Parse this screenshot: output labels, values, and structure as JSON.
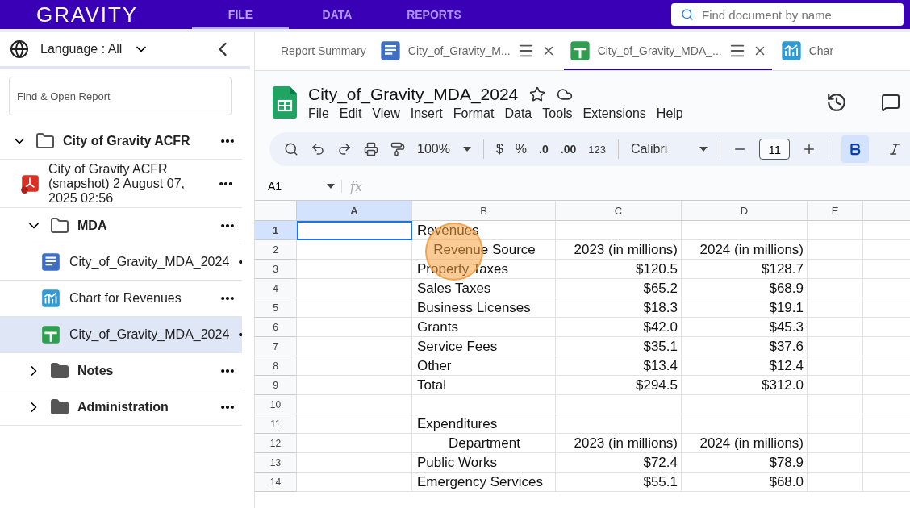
{
  "header": {
    "logo": "GRAVITY",
    "nav": [
      {
        "label": "FILE",
        "selected": true
      },
      {
        "label": "DATA",
        "selected": false
      },
      {
        "label": "REPORTS",
        "selected": false
      }
    ],
    "search": {
      "placeholder": "Find document by name"
    }
  },
  "sidebar": {
    "language": "Language : All",
    "search": {
      "placeholder": "Find & Open Report"
    },
    "tree": [
      {
        "label": "City of Gravity ACFR",
        "kind": "folder",
        "expanded": true,
        "children": [
          {
            "label": "City of Gravity ACFR (snapshot) 2 August 07, 2025 02:56",
            "kind": "pdf",
            "selected": false
          },
          {
            "label": "MDA",
            "kind": "folder",
            "expanded": true,
            "children": [
              {
                "label": "City_of_Gravity_MDA_2024",
                "kind": "doc",
                "selected": false
              },
              {
                "label": "Chart for Revenues",
                "kind": "chart",
                "selected": false
              },
              {
                "label": "City_of_Gravity_MDA_2024",
                "kind": "sheet",
                "selected": true
              }
            ]
          },
          {
            "label": "Notes",
            "kind": "folder",
            "expanded": false
          },
          {
            "label": "Administration",
            "kind": "folder",
            "expanded": false
          }
        ]
      }
    ]
  },
  "tabs": [
    {
      "label": "Report Summary",
      "kind": "text",
      "selected": false,
      "closable": false
    },
    {
      "label": "City_of_Gravity_M...",
      "kind": "doc",
      "selected": false,
      "closable": true
    },
    {
      "label": "City_of_Gravity_MDA_...",
      "kind": "sheet",
      "selected": true,
      "closable": true
    },
    {
      "label": "Char",
      "kind": "chart",
      "selected": false,
      "closable": false
    }
  ],
  "document": {
    "title": "City_of_Gravity_MDA_2024",
    "menu": [
      "File",
      "Edit",
      "View",
      "Insert",
      "Format",
      "Data",
      "Tools",
      "Extensions",
      "Help"
    ],
    "toolbar": [
      {
        "kind": "search"
      },
      {
        "kind": "undo"
      },
      {
        "kind": "redo"
      },
      {
        "kind": "print"
      },
      {
        "kind": "paint"
      },
      {
        "kind": "dropdown",
        "label": "100%"
      },
      {
        "kind": "divider"
      },
      {
        "kind": "text",
        "label": "$"
      },
      {
        "kind": "text",
        "label": "%"
      },
      {
        "kind": "decrease",
        "label": ".0"
      },
      {
        "kind": "increase",
        "label": ".00"
      },
      {
        "kind": "text",
        "label": "123"
      },
      {
        "kind": "divider"
      },
      {
        "kind": "font",
        "label": "Calibri"
      },
      {
        "kind": "divider"
      },
      {
        "kind": "minus"
      },
      {
        "kind": "size",
        "label": "11"
      },
      {
        "kind": "plus"
      },
      {
        "kind": "divider"
      },
      {
        "kind": "bold",
        "selected": true
      },
      {
        "kind": "italic",
        "selected": false
      }
    ],
    "name_box": "A1",
    "formula_label": "fx",
    "columns": [
      {
        "label": "A",
        "selected": true
      },
      {
        "label": "B",
        "selected": false
      },
      {
        "label": "C",
        "selected": false
      },
      {
        "label": "D",
        "selected": false
      },
      {
        "label": "E",
        "selected": false
      }
    ],
    "rows": [
      {
        "number": "1",
        "selected": true,
        "b": "Revenues"
      },
      {
        "number": "2",
        "selected": false,
        "kind": "heading",
        "b": "Revenue Source",
        "c": "2023 (in millions)",
        "d": "2024 (in millions)"
      },
      {
        "number": "3",
        "selected": false,
        "b": "Property Taxes",
        "c": "$120.5",
        "d": "$128.7"
      },
      {
        "number": "4",
        "selected": false,
        "b": "Sales Taxes",
        "c": "$65.2",
        "d": "$68.9"
      },
      {
        "number": "5",
        "selected": false,
        "b": "Business Licenses",
        "c": "$18.3",
        "d": "$19.1"
      },
      {
        "number": "6",
        "selected": false,
        "b": "Grants",
        "c": "$42.0",
        "d": "$45.3"
      },
      {
        "number": "7",
        "selected": false,
        "b": "Service Fees",
        "c": "$35.1",
        "d": "$37.6"
      },
      {
        "number": "8",
        "selected": false,
        "b": "Other",
        "c": "$13.4",
        "d": "$12.4"
      },
      {
        "number": "9",
        "selected": false,
        "b": "Total",
        "c": "$294.5",
        "d": "$312.0"
      },
      {
        "number": "10",
        "selected": false
      },
      {
        "number": "11",
        "selected": false,
        "b": "Expenditures"
      },
      {
        "number": "12",
        "selected": false,
        "kind": "heading",
        "b": "Department",
        "c": "2023 (in millions)",
        "d": "2024 (in millions)"
      },
      {
        "number": "13",
        "selected": false,
        "b": "Public Works",
        "c": "$72.4",
        "d": "$78.9"
      },
      {
        "number": "14",
        "selected": false,
        "b": "Emergency Services",
        "c": "$55.1",
        "d": "$68.0"
      }
    ]
  }
}
